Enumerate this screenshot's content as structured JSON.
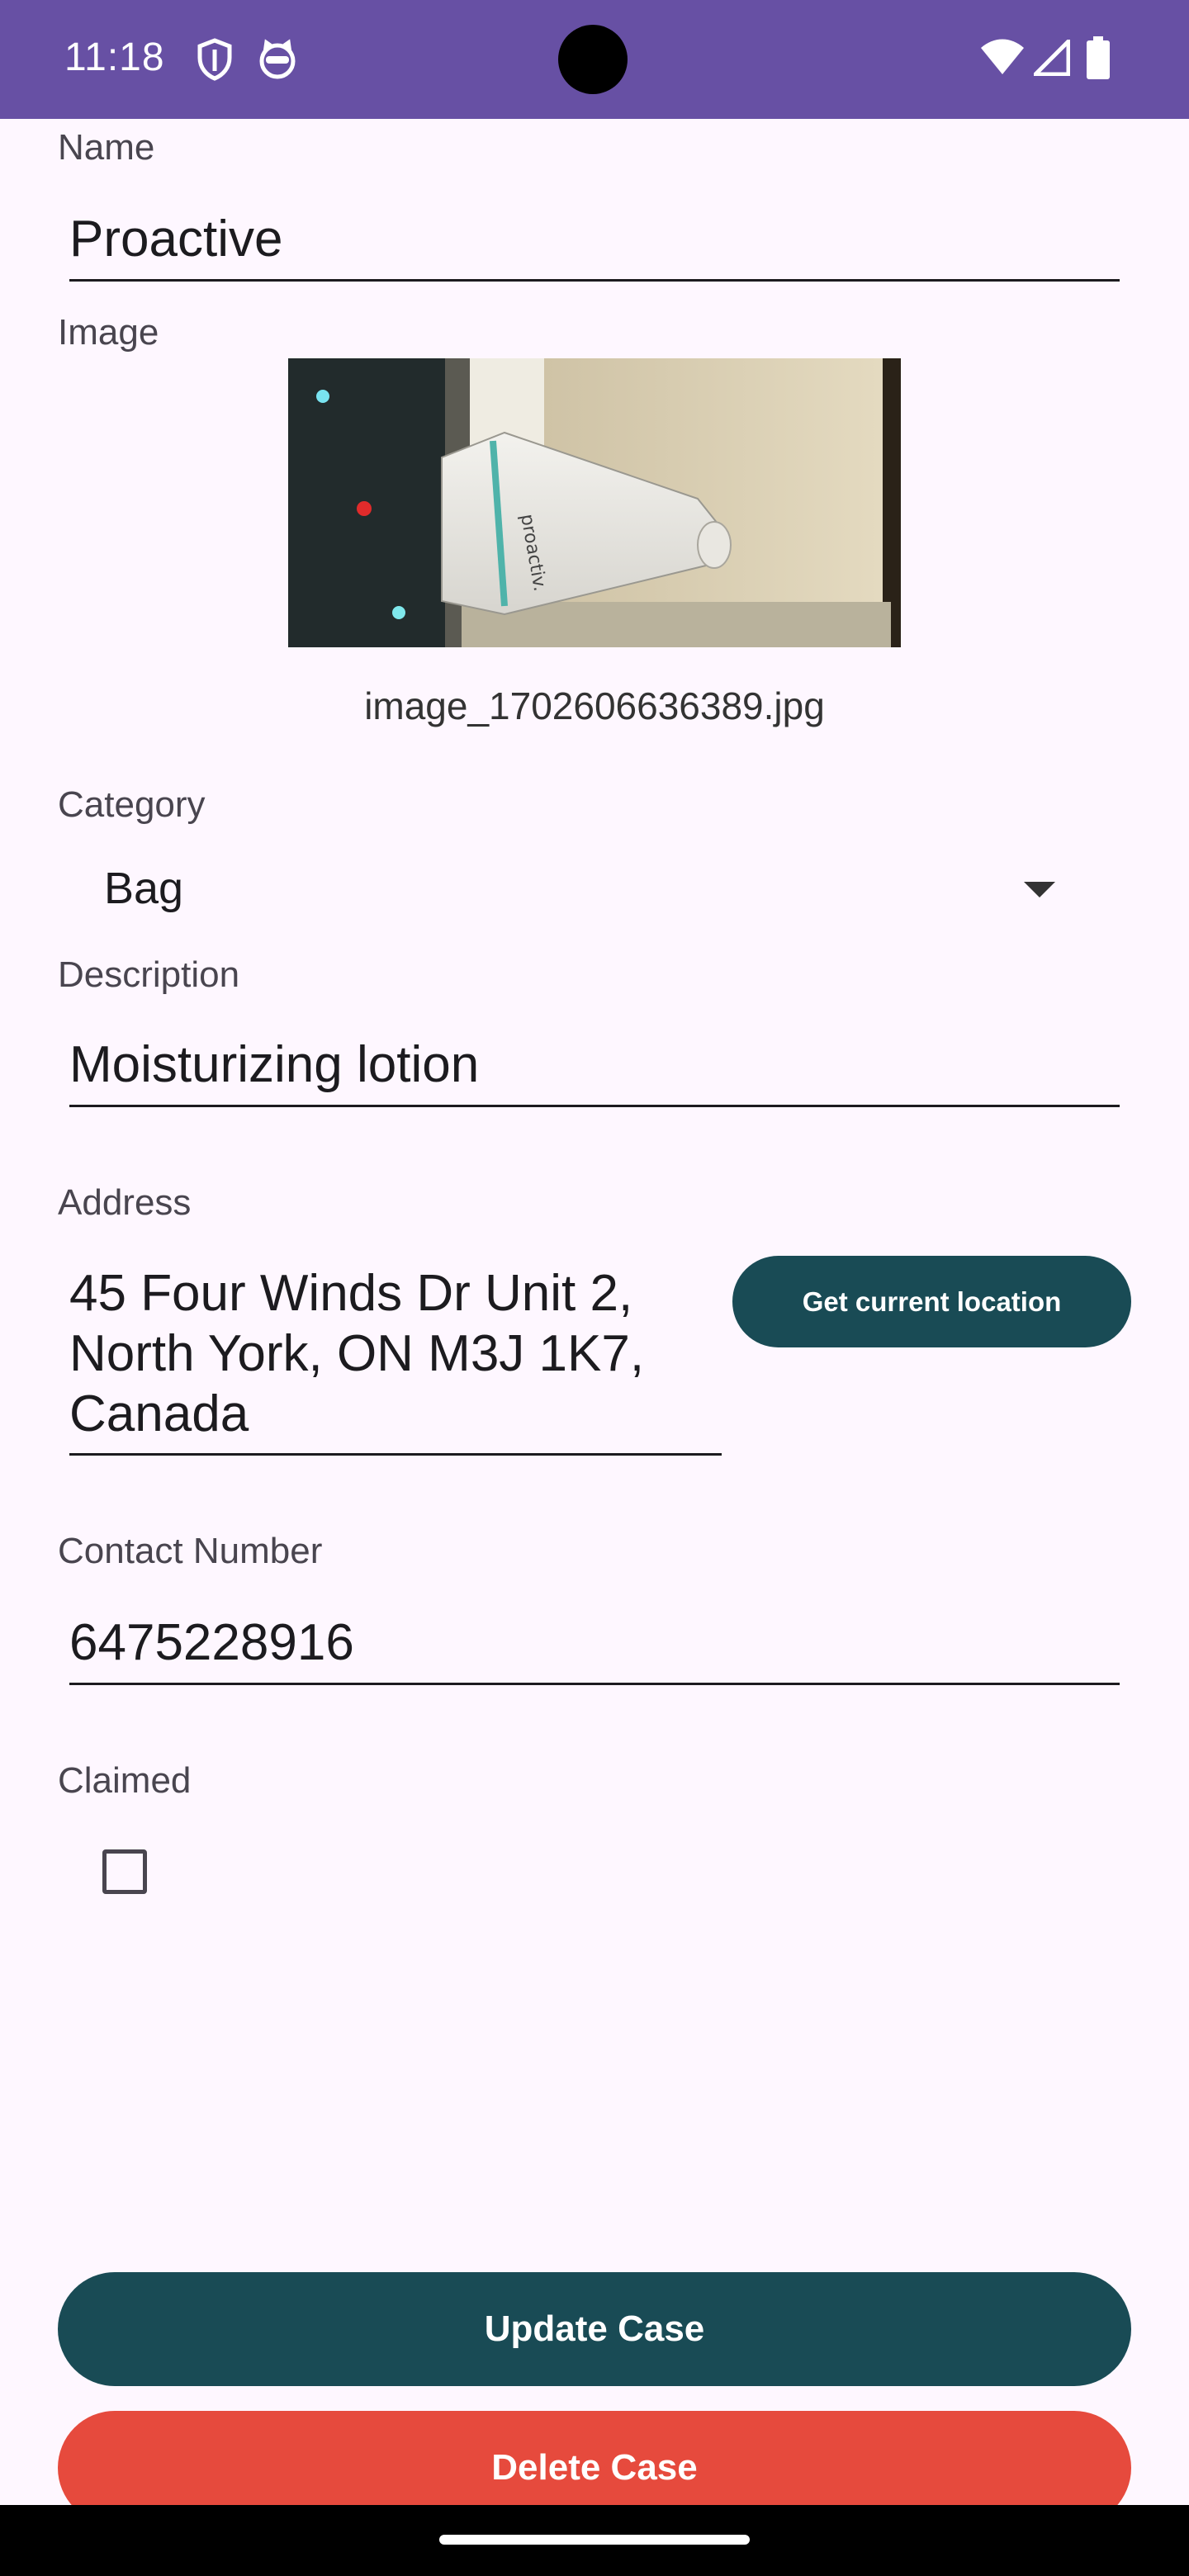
{
  "status_bar": {
    "time": "11:18",
    "icons": [
      "shield-icon",
      "cat-face-icon",
      "wifi-icon",
      "signal-icon",
      "battery-icon"
    ]
  },
  "form": {
    "name": {
      "label": "Name",
      "value": "Proactive"
    },
    "image": {
      "label": "Image",
      "filename": "image_1702606636389.jpg"
    },
    "category": {
      "label": "Category",
      "selected": "Bag"
    },
    "description": {
      "label": "Description",
      "value": "Moisturizing lotion"
    },
    "address": {
      "label": "Address",
      "value": "45 Four Winds Dr Unit 2, North York, ON M3J 1K7, Canada",
      "button_label": "Get current location"
    },
    "contact": {
      "label": "Contact Number",
      "value": "6475228916"
    },
    "claimed": {
      "label": "Claimed",
      "checked": false
    }
  },
  "actions": {
    "update_label": "Update Case",
    "delete_label": "Delete Case"
  },
  "colors": {
    "status_bar": "#6750A4",
    "primary_button": "#194B55",
    "danger_button": "#E64A3D",
    "background": "#FEF7FF"
  }
}
